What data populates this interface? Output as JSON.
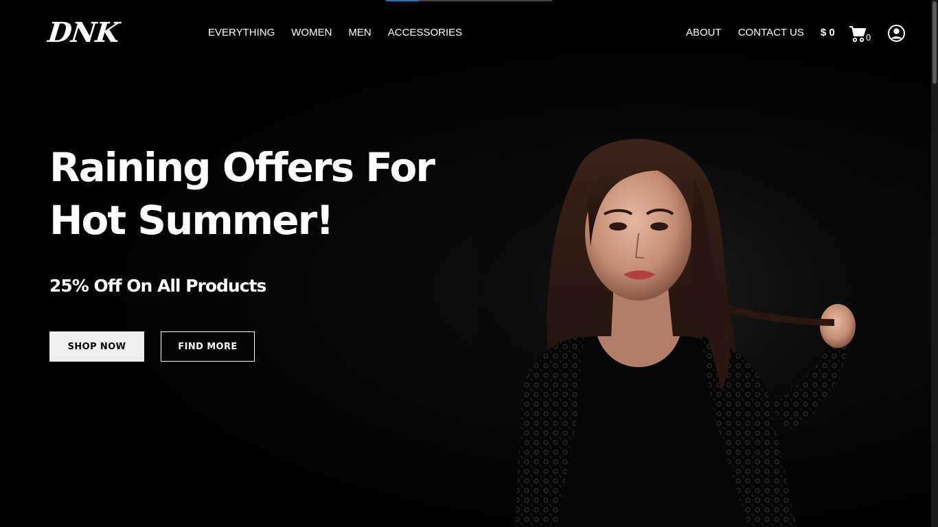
{
  "brand": {
    "logo_text": "DNK"
  },
  "nav": {
    "left": [
      {
        "label": "EVERYTHING"
      },
      {
        "label": "WOMEN"
      },
      {
        "label": "MEN"
      },
      {
        "label": "ACCESSORIES"
      }
    ],
    "about": "ABOUT",
    "contact": "CONTACT US",
    "cart_total": "$ 0",
    "cart_count": "0",
    "cart_icon": "shopping-cart-icon",
    "account_icon": "user-circle-icon"
  },
  "hero": {
    "title_line1": "Raining Offers For",
    "title_line2": "Hot Summer!",
    "subtitle": "25% Off On All Products",
    "primary_button": "SHOP NOW",
    "secondary_button": "FIND MORE"
  },
  "loading": {
    "progress": 0.2
  },
  "colors": {
    "background": "#000000",
    "text": "#ffffff",
    "primary_button_bg": "#eeeeee",
    "accent": "#1e73be"
  }
}
